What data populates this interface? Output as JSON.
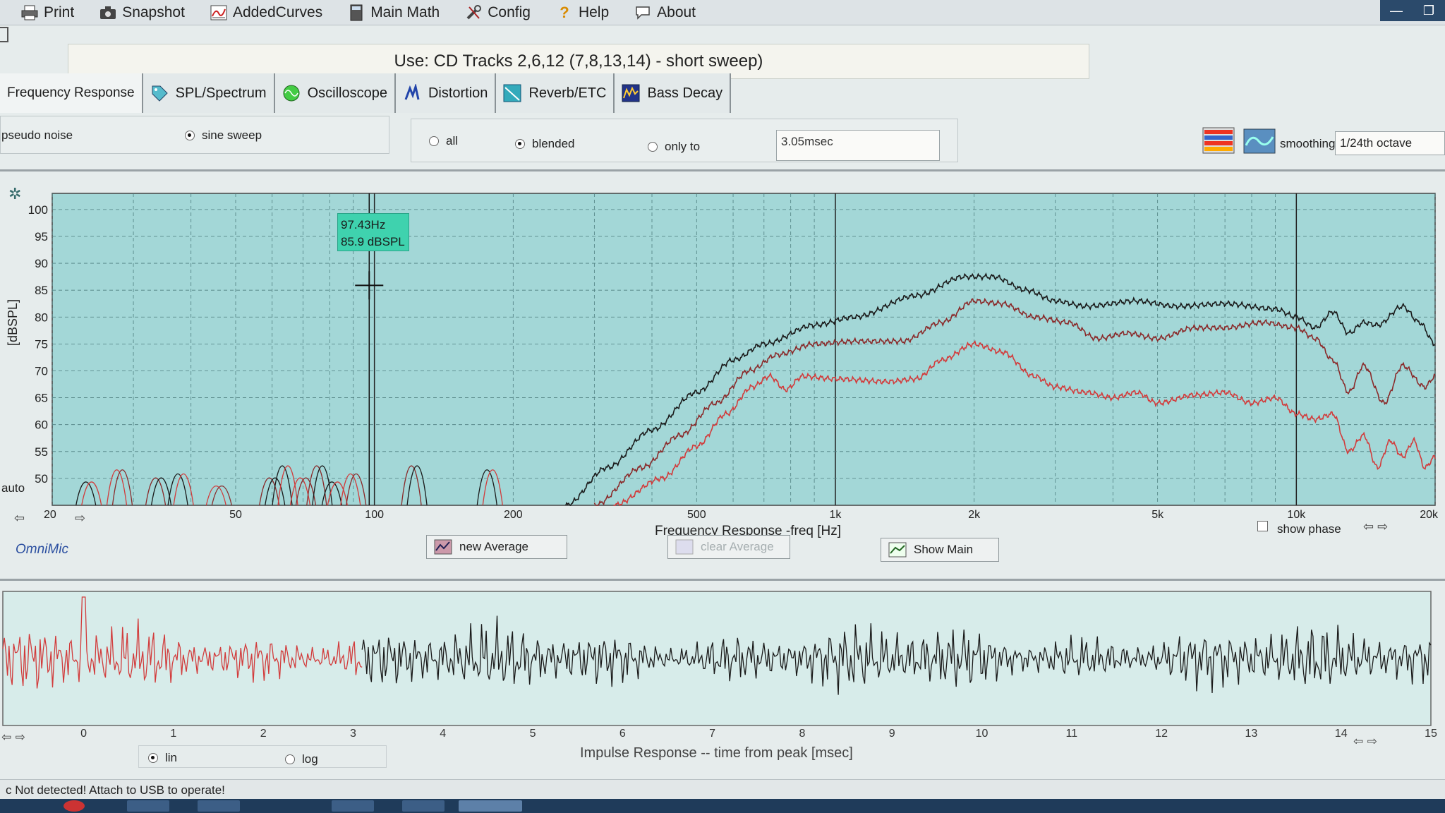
{
  "menu": {
    "items": [
      {
        "label": "Print",
        "icon": "printer-icon"
      },
      {
        "label": "Snapshot",
        "icon": "camera-icon"
      },
      {
        "label": "AddedCurves",
        "icon": "curves-icon"
      },
      {
        "label": "Main Math",
        "icon": "calculator-icon"
      },
      {
        "label": "Config",
        "icon": "tools-icon"
      },
      {
        "label": "Help",
        "icon": "question-icon"
      },
      {
        "label": "About",
        "icon": "speech-bubble-icon"
      }
    ]
  },
  "banner": {
    "text": "Use: CD Tracks 2,6,12 (7,8,13,14) - short sweep)"
  },
  "tabs": [
    {
      "label": "Frequency Response",
      "active": true
    },
    {
      "label": "SPL/Spectrum",
      "icon": "tag-icon"
    },
    {
      "label": "Oscilloscope",
      "icon": "scope-icon"
    },
    {
      "label": "Distortion",
      "icon": "distortion-icon"
    },
    {
      "label": "Reverb/ETC",
      "icon": "reverb-icon"
    },
    {
      "label": "Bass Decay",
      "icon": "bass-decay-icon"
    }
  ],
  "signal": {
    "pseudo_noise": "pseudo noise",
    "sine_sweep": "sine sweep",
    "selected": "sine sweep"
  },
  "window": {
    "all": "all",
    "blended": "blended",
    "only_to": "only to",
    "selected": "blended",
    "time_value": "3.05msec"
  },
  "smoothing": {
    "label": "smoothing",
    "value": "1/24th octave"
  },
  "tooltip": {
    "freq": "97.43Hz",
    "spl": "85.9 dBSPL"
  },
  "fr_labels": {
    "y_title": "[dBSPL]",
    "auto": "auto",
    "x_title": "Frequency Response -freq [Hz]",
    "show_phase": "show phase",
    "arrows": "⇦ ⇨"
  },
  "buttons": {
    "new_average": "new Average",
    "clear_average": "clear Average",
    "show_main": "Show Main"
  },
  "omnimic": "OmniMic",
  "ir": {
    "x_title": "Impulse Response  -- time from peak [msec]",
    "lin": "lin",
    "log": "log",
    "selected": "lin"
  },
  "status": "c Not detected! Attach to USB to operate!",
  "colors": {
    "plot_bg": "#a3d7d7",
    "curve_black": "#1a1a1a",
    "curve_dark_red": "#8a2a2a",
    "curve_red": "#d23b3b",
    "accent": "#3fd2ae"
  },
  "chart_data": [
    {
      "type": "line",
      "x_scale": "log",
      "xlim": [
        20,
        20000
      ],
      "ylim": [
        45,
        103
      ],
      "ylabel": "[dBSPL]",
      "xlabel": "Frequency Response -freq [Hz]",
      "y_ticks": [
        100,
        95,
        90,
        85,
        80,
        75,
        70,
        65,
        60,
        55,
        50
      ],
      "x_ticks": [
        {
          "v": 20,
          "label": "20"
        },
        {
          "v": 50,
          "label": "50"
        },
        {
          "v": 100,
          "label": "100"
        },
        {
          "v": 200,
          "label": "200"
        },
        {
          "v": 500,
          "label": "500"
        },
        {
          "v": 1000,
          "label": "1k"
        },
        {
          "v": 2000,
          "label": "2k"
        },
        {
          "v": 5000,
          "label": "5k"
        },
        {
          "v": 10000,
          "label": "10k"
        },
        {
          "v": 20000,
          "label": "20k"
        }
      ],
      "cursor": {
        "freq": 97.43,
        "spl": 85.9
      },
      "series": [
        {
          "color": "#1a1a1a",
          "points": [
            [
              260,
              45
            ],
            [
              320,
              52
            ],
            [
              400,
              59
            ],
            [
              500,
              66
            ],
            [
              600,
              72
            ],
            [
              700,
              75
            ],
            [
              900,
              78.5
            ],
            [
              1100,
              80
            ],
            [
              1500,
              84
            ],
            [
              1900,
              87.5
            ],
            [
              2200,
              87.5
            ],
            [
              2600,
              85
            ],
            [
              3000,
              83
            ],
            [
              3500,
              82
            ],
            [
              4500,
              83
            ],
            [
              5500,
              82
            ],
            [
              7000,
              82.5
            ],
            [
              9000,
              81.5
            ],
            [
              10000,
              80
            ],
            [
              11000,
              78
            ],
            [
              12000,
              81
            ],
            [
              13000,
              77
            ],
            [
              14000,
              79
            ],
            [
              15000,
              78.5
            ],
            [
              17000,
              82
            ],
            [
              18500,
              79
            ],
            [
              20000,
              75
            ]
          ]
        },
        {
          "color": "#8a2a2a",
          "points": [
            [
              300,
              45
            ],
            [
              380,
              52
            ],
            [
              460,
              58
            ],
            [
              550,
              64
            ],
            [
              650,
              70
            ],
            [
              750,
              73
            ],
            [
              900,
              75
            ],
            [
              1100,
              75.5
            ],
            [
              1400,
              75.5
            ],
            [
              1700,
              79
            ],
            [
              2000,
              83
            ],
            [
              2300,
              82.5
            ],
            [
              2700,
              80
            ],
            [
              3200,
              79
            ],
            [
              3700,
              76
            ],
            [
              4300,
              77
            ],
            [
              5000,
              76
            ],
            [
              6000,
              78
            ],
            [
              7000,
              78
            ],
            [
              8500,
              79
            ],
            [
              10000,
              78
            ],
            [
              11000,
              76
            ],
            [
              12000,
              72
            ],
            [
              13000,
              66
            ],
            [
              14000,
              71
            ],
            [
              15500,
              64
            ],
            [
              17000,
              71
            ],
            [
              19000,
              67
            ],
            [
              20000,
              69
            ]
          ]
        },
        {
          "color": "#d23b3b",
          "points": [
            [
              330,
              45
            ],
            [
              420,
              50
            ],
            [
              500,
              56
            ],
            [
              580,
              62
            ],
            [
              660,
              67
            ],
            [
              720,
              69
            ],
            [
              780,
              66.5
            ],
            [
              850,
              69
            ],
            [
              1000,
              68.5
            ],
            [
              1300,
              68
            ],
            [
              1500,
              68.5
            ],
            [
              1700,
              72
            ],
            [
              2000,
              75
            ],
            [
              2300,
              73.5
            ],
            [
              2700,
              69
            ],
            [
              3000,
              67
            ],
            [
              3500,
              66
            ],
            [
              4000,
              65
            ],
            [
              4500,
              66
            ],
            [
              5000,
              64
            ],
            [
              6000,
              65.5
            ],
            [
              7000,
              66
            ],
            [
              8000,
              64
            ],
            [
              9000,
              65
            ],
            [
              10000,
              62
            ],
            [
              11000,
              61
            ],
            [
              12000,
              62
            ],
            [
              13000,
              55
            ],
            [
              14000,
              58
            ],
            [
              15000,
              52
            ],
            [
              16000,
              57
            ],
            [
              17000,
              54
            ],
            [
              18000,
              57
            ],
            [
              19000,
              52
            ],
            [
              20000,
              54
            ]
          ]
        }
      ],
      "noise_peaks": [
        [
          24,
          50
        ],
        [
          28,
          53
        ],
        [
          34,
          51
        ],
        [
          38,
          52
        ],
        [
          46,
          49
        ],
        [
          60,
          51
        ],
        [
          64,
          54
        ],
        [
          70,
          51
        ],
        [
          76,
          54
        ],
        [
          82,
          50
        ],
        [
          90,
          52
        ],
        [
          122,
          54
        ],
        [
          178,
          53
        ]
      ]
    },
    {
      "type": "line",
      "xlabel": "Impulse Response  -- time from peak [msec]",
      "xlim": [
        -0.9,
        15
      ],
      "x_ticks": [
        0,
        1,
        2,
        3,
        4,
        5,
        6,
        7,
        8,
        9,
        10,
        11,
        12,
        13,
        14,
        15
      ],
      "series": [
        {
          "color": "#d23b3b",
          "x_range": [
            -0.9,
            3.1
          ]
        },
        {
          "color": "#1a1a1a",
          "x_range": [
            3.1,
            15
          ]
        }
      ]
    }
  ]
}
